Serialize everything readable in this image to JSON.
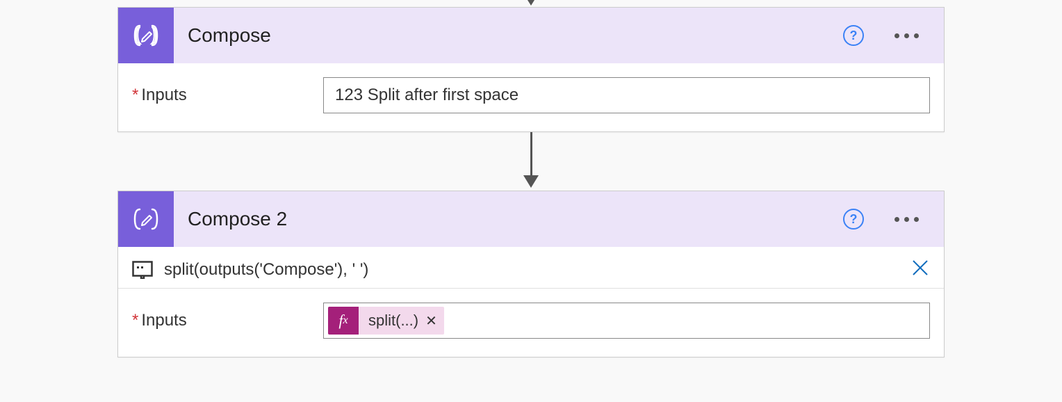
{
  "steps": [
    {
      "title": "Compose",
      "input_label": "Inputs",
      "input_value": "123 Split after first space"
    },
    {
      "title": "Compose 2",
      "peek_expression": "split(outputs('Compose'), ' ')",
      "input_label": "Inputs",
      "token": {
        "fx_label": "fx",
        "text": "split(...)"
      }
    }
  ]
}
